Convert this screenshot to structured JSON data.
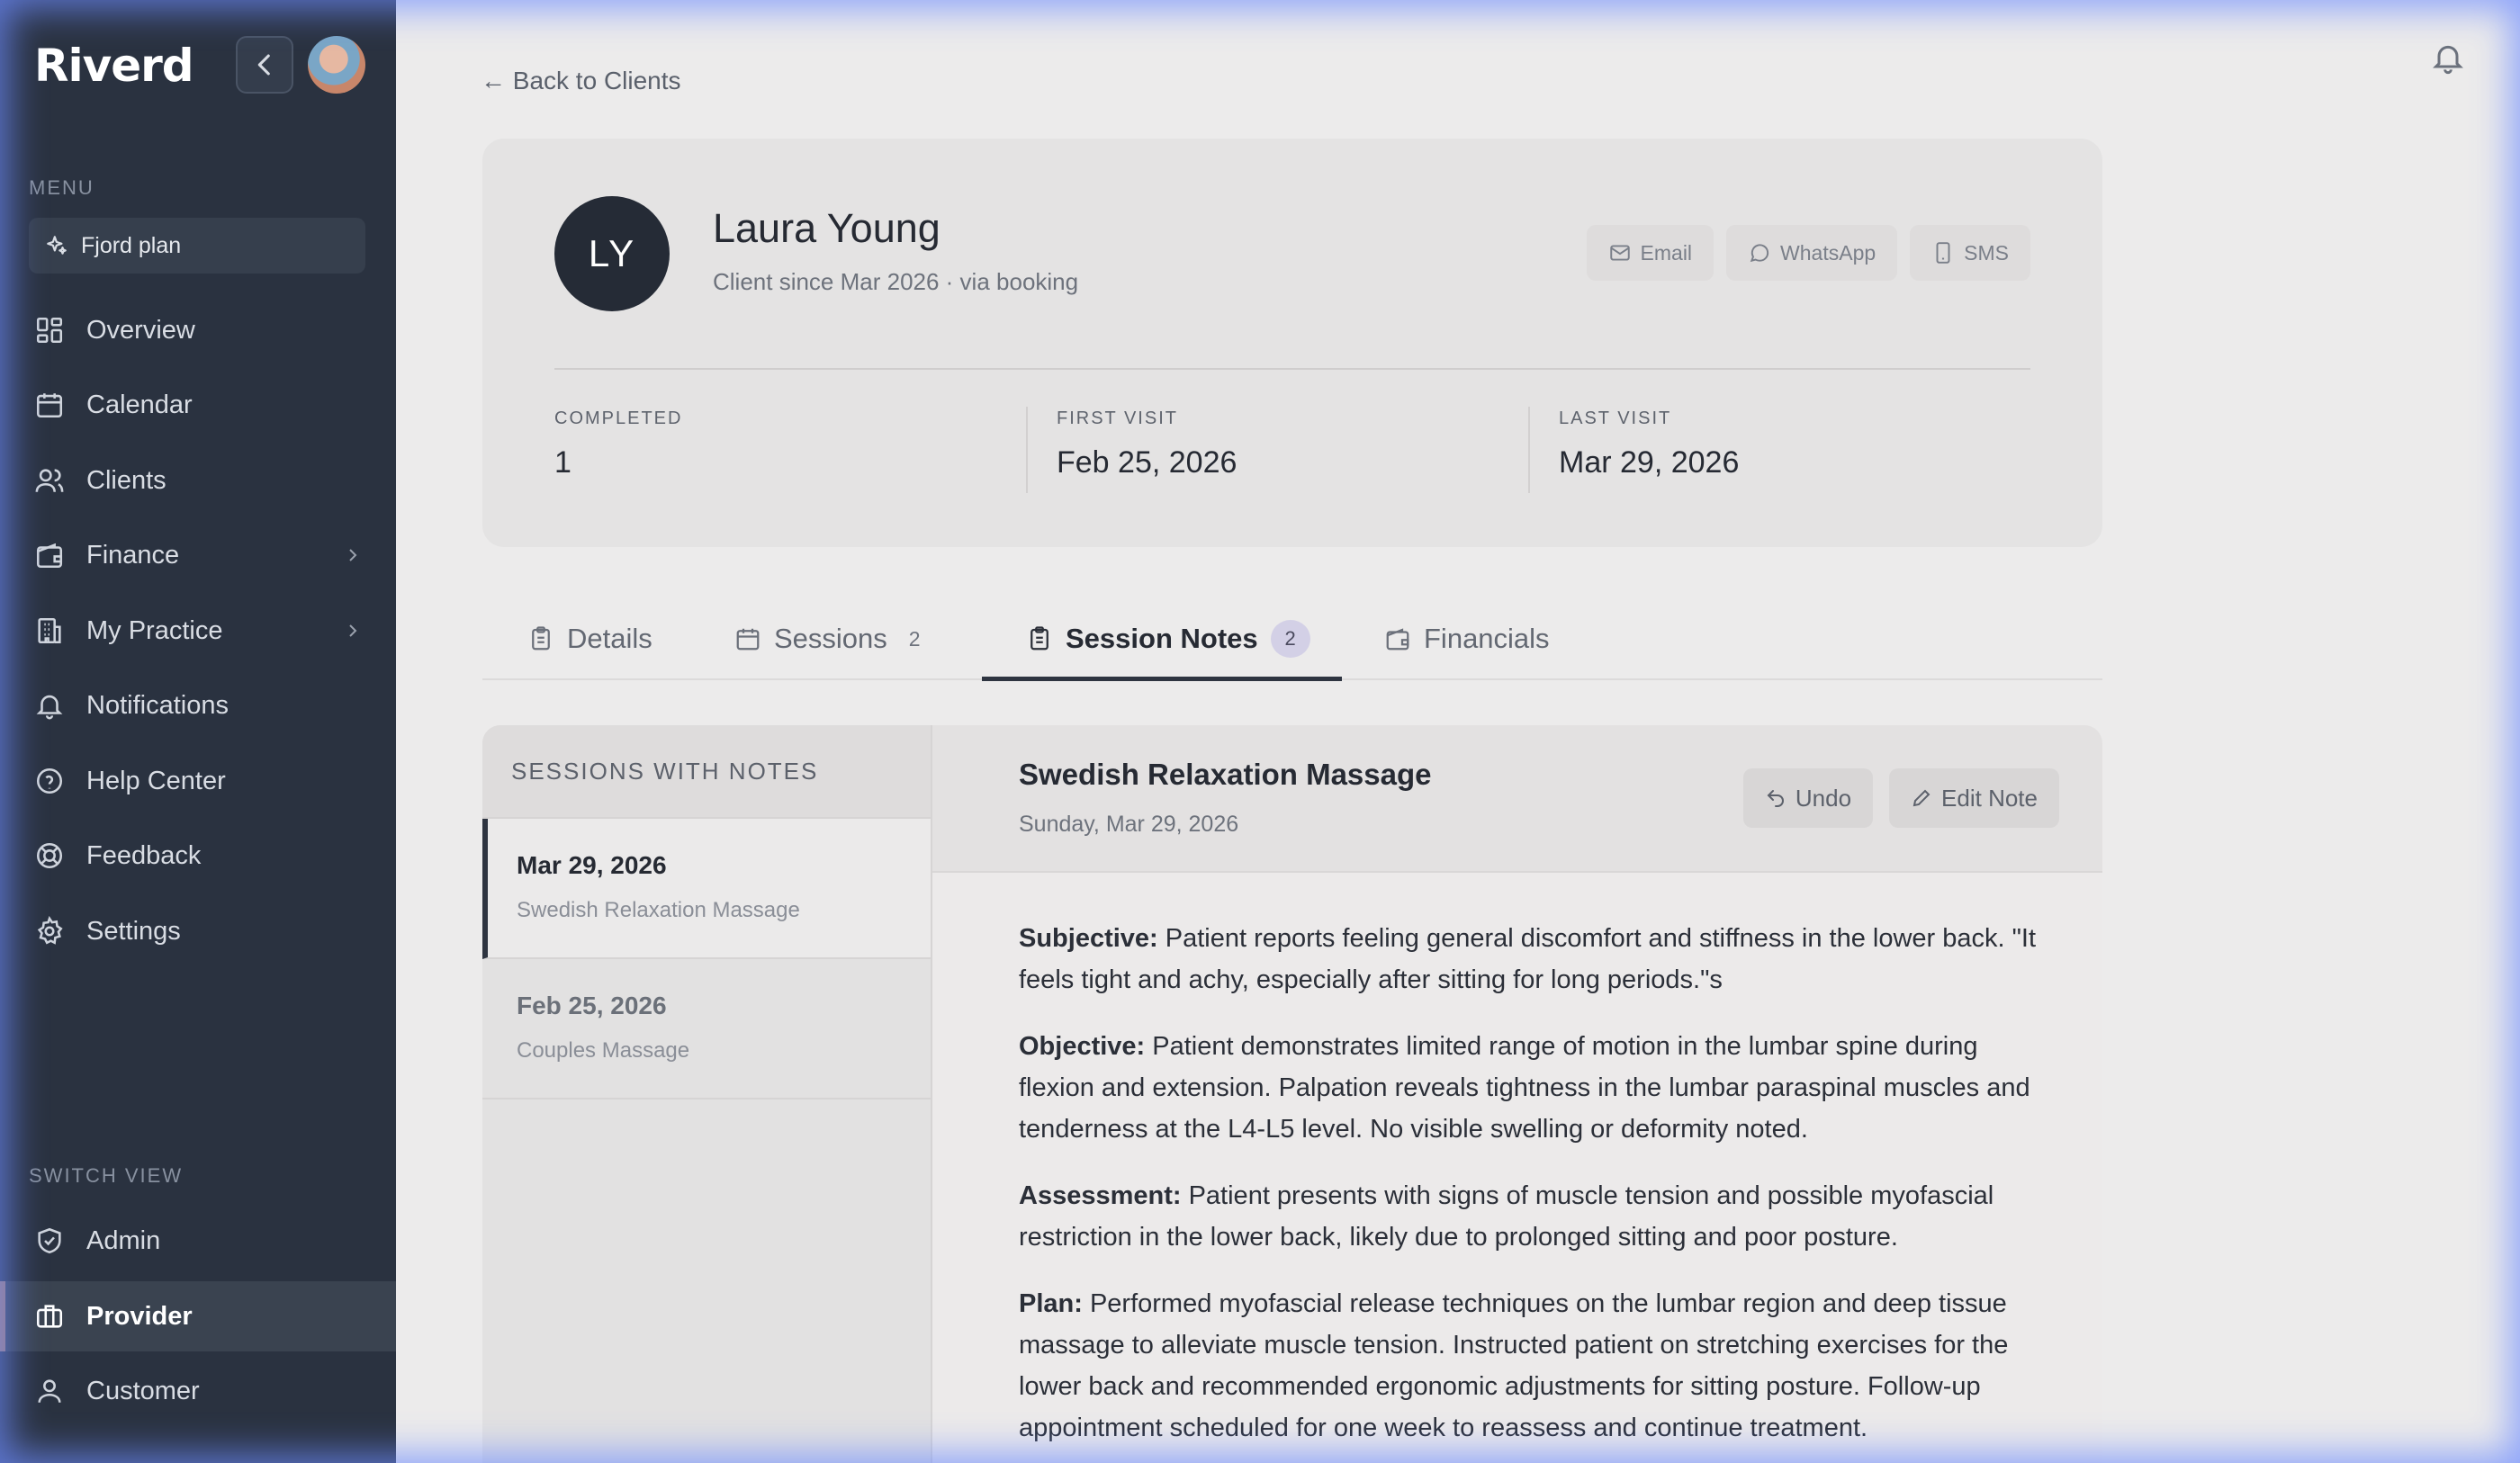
{
  "sidebar": {
    "brand": "Riverd",
    "menu_label": "MENU",
    "plan": "Fjord plan",
    "items": [
      {
        "label": "Overview",
        "icon": "grid-icon"
      },
      {
        "label": "Calendar",
        "icon": "calendar-icon"
      },
      {
        "label": "Clients",
        "icon": "users-icon"
      },
      {
        "label": "Finance",
        "icon": "wallet-icon",
        "has_chevron": true
      },
      {
        "label": "My Practice",
        "icon": "building-icon",
        "has_chevron": true
      },
      {
        "label": "Notifications",
        "icon": "bell-icon"
      },
      {
        "label": "Help Center",
        "icon": "help-circle-icon"
      },
      {
        "label": "Feedback",
        "icon": "lifebuoy-icon"
      },
      {
        "label": "Settings",
        "icon": "gear-icon"
      }
    ],
    "switch_label": "SWITCH VIEW",
    "views": [
      {
        "label": "Admin",
        "icon": "shield-icon",
        "active": false
      },
      {
        "label": "Provider",
        "icon": "briefcase-icon",
        "active": true
      },
      {
        "label": "Customer",
        "icon": "user-icon",
        "active": false
      }
    ]
  },
  "header": {
    "back_link": "← Back to Clients"
  },
  "client": {
    "initials": "LY",
    "name": "Laura Young",
    "since": "Client since Mar 2026 · via booking",
    "contact": [
      "Email",
      "WhatsApp",
      "SMS"
    ],
    "stats": [
      {
        "label": "COMPLETED",
        "value": "1"
      },
      {
        "label": "FIRST VISIT",
        "value": "Feb 25, 2026"
      },
      {
        "label": "LAST VISIT",
        "value": "Mar 29, 2026"
      }
    ]
  },
  "tabs": [
    {
      "label": "Details"
    },
    {
      "label": "Sessions",
      "count": "2"
    },
    {
      "label": "Session Notes",
      "count": "2",
      "active": true
    },
    {
      "label": "Financials"
    }
  ],
  "notes": {
    "list_header": "SESSIONS WITH NOTES",
    "entries": [
      {
        "date": "Mar 29, 2026",
        "service": "Swedish Relaxation Massage",
        "selected": true
      },
      {
        "date": "Feb 25, 2026",
        "service": "Couples Massage",
        "selected": false
      }
    ],
    "detail": {
      "title": "Swedish Relaxation Massage",
      "date": "Sunday, Mar 29, 2026",
      "undo_label": "Undo",
      "edit_label": "Edit Note",
      "subjective_label": "Subjective:",
      "subjective": " Patient reports feeling general discomfort and stiffness in the lower back. \"It feels tight and achy, especially after sitting for long periods.\"s",
      "objective_label": "Objective:",
      "objective": " Patient demonstrates limited range of motion in the lumbar spine during flexion and extension. Palpation reveals tightness in the lumbar paraspinal muscles and tenderness at the L4-L5 level. No visible swelling or deformity noted.",
      "assessment_label": "Assessment:",
      "assessment": " Patient presents with signs of muscle tension and possible myofascial restriction in the lower back, likely due to prolonged sitting and poor posture.",
      "plan_label": "Plan:",
      "plan": " Performed myofascial release techniques on the lumbar region and deep tissue massage to alleviate muscle tension. Instructed patient on stretching exercises for the lower back and recommended ergonomic adjustments for sitting posture. Follow-up appointment scheduled for one week to reassess and continue treatment."
    }
  }
}
